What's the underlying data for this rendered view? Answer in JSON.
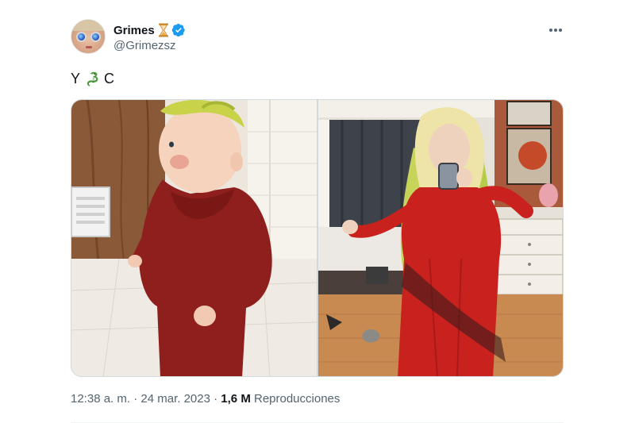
{
  "author": {
    "display_name": "Grimes",
    "handle": "@Grimezsz",
    "verified": true,
    "name_emoji": "hourglass-icon"
  },
  "tweet": {
    "text_before": "Y",
    "emoji": "dragon-icon",
    "text_after": "C"
  },
  "media": {
    "count": 2
  },
  "meta": {
    "time": "12:38 a. m.",
    "separator": "·",
    "date": "24 mar. 2023",
    "views_count": "1,6 M",
    "views_label": "Reproducciones"
  },
  "colors": {
    "accent": "#1d9bf0",
    "secondary_text": "#536471",
    "primary_text": "#0f1419"
  }
}
